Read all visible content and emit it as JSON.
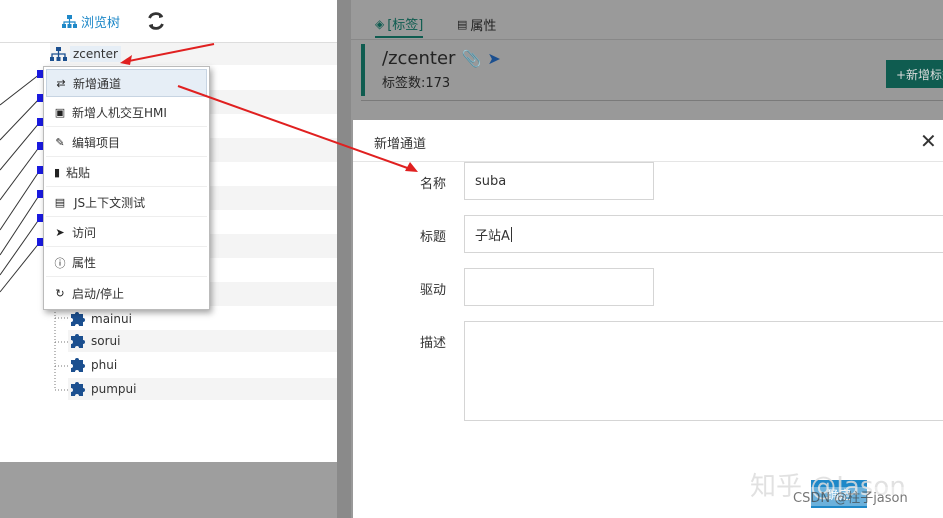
{
  "toolbar": {
    "browse_tree_label": "浏览树"
  },
  "tree": {
    "root_label": "zcenter",
    "children": [
      "mainui",
      "sorui",
      "phui",
      "pumpui"
    ]
  },
  "context_menu": {
    "items": [
      {
        "label": "新增通道",
        "icon": "shuffle-icon"
      },
      {
        "label": "新增人机交互HMI",
        "icon": "puzzle-icon"
      },
      {
        "label": "编辑项目",
        "icon": "pencil-icon"
      },
      {
        "label": "粘贴",
        "icon": "clipboard-icon"
      },
      {
        "label": "JS上下文测试",
        "icon": "list-icon"
      },
      {
        "label": "访问",
        "icon": "send-icon"
      },
      {
        "label": "属性",
        "icon": "info-icon"
      },
      {
        "label": "启动/停止",
        "icon": "refresh-icon"
      }
    ]
  },
  "tabs": {
    "tags_label": "[标签]",
    "props_label": "属性"
  },
  "panel": {
    "path": "/zcenter",
    "tag_count": "标签数:173",
    "add_tag_btn": "+新增标签"
  },
  "dialog": {
    "title": "新增通道",
    "fields": {
      "name_label": "名称",
      "name_value": "suba",
      "title_label": "标题",
      "title_value": "子站A",
      "driver_label": "驱动",
      "driver_value": "",
      "desc_label": "描述",
      "desc_value": ""
    },
    "ok_button": "确定"
  },
  "watermark": {
    "main": "知乎 @Jason",
    "sub": "CSDN @柱子jason"
  },
  "colors": {
    "accent": "#1e88c8",
    "teal": "#1b7d6e",
    "arrow": "#e02020"
  }
}
